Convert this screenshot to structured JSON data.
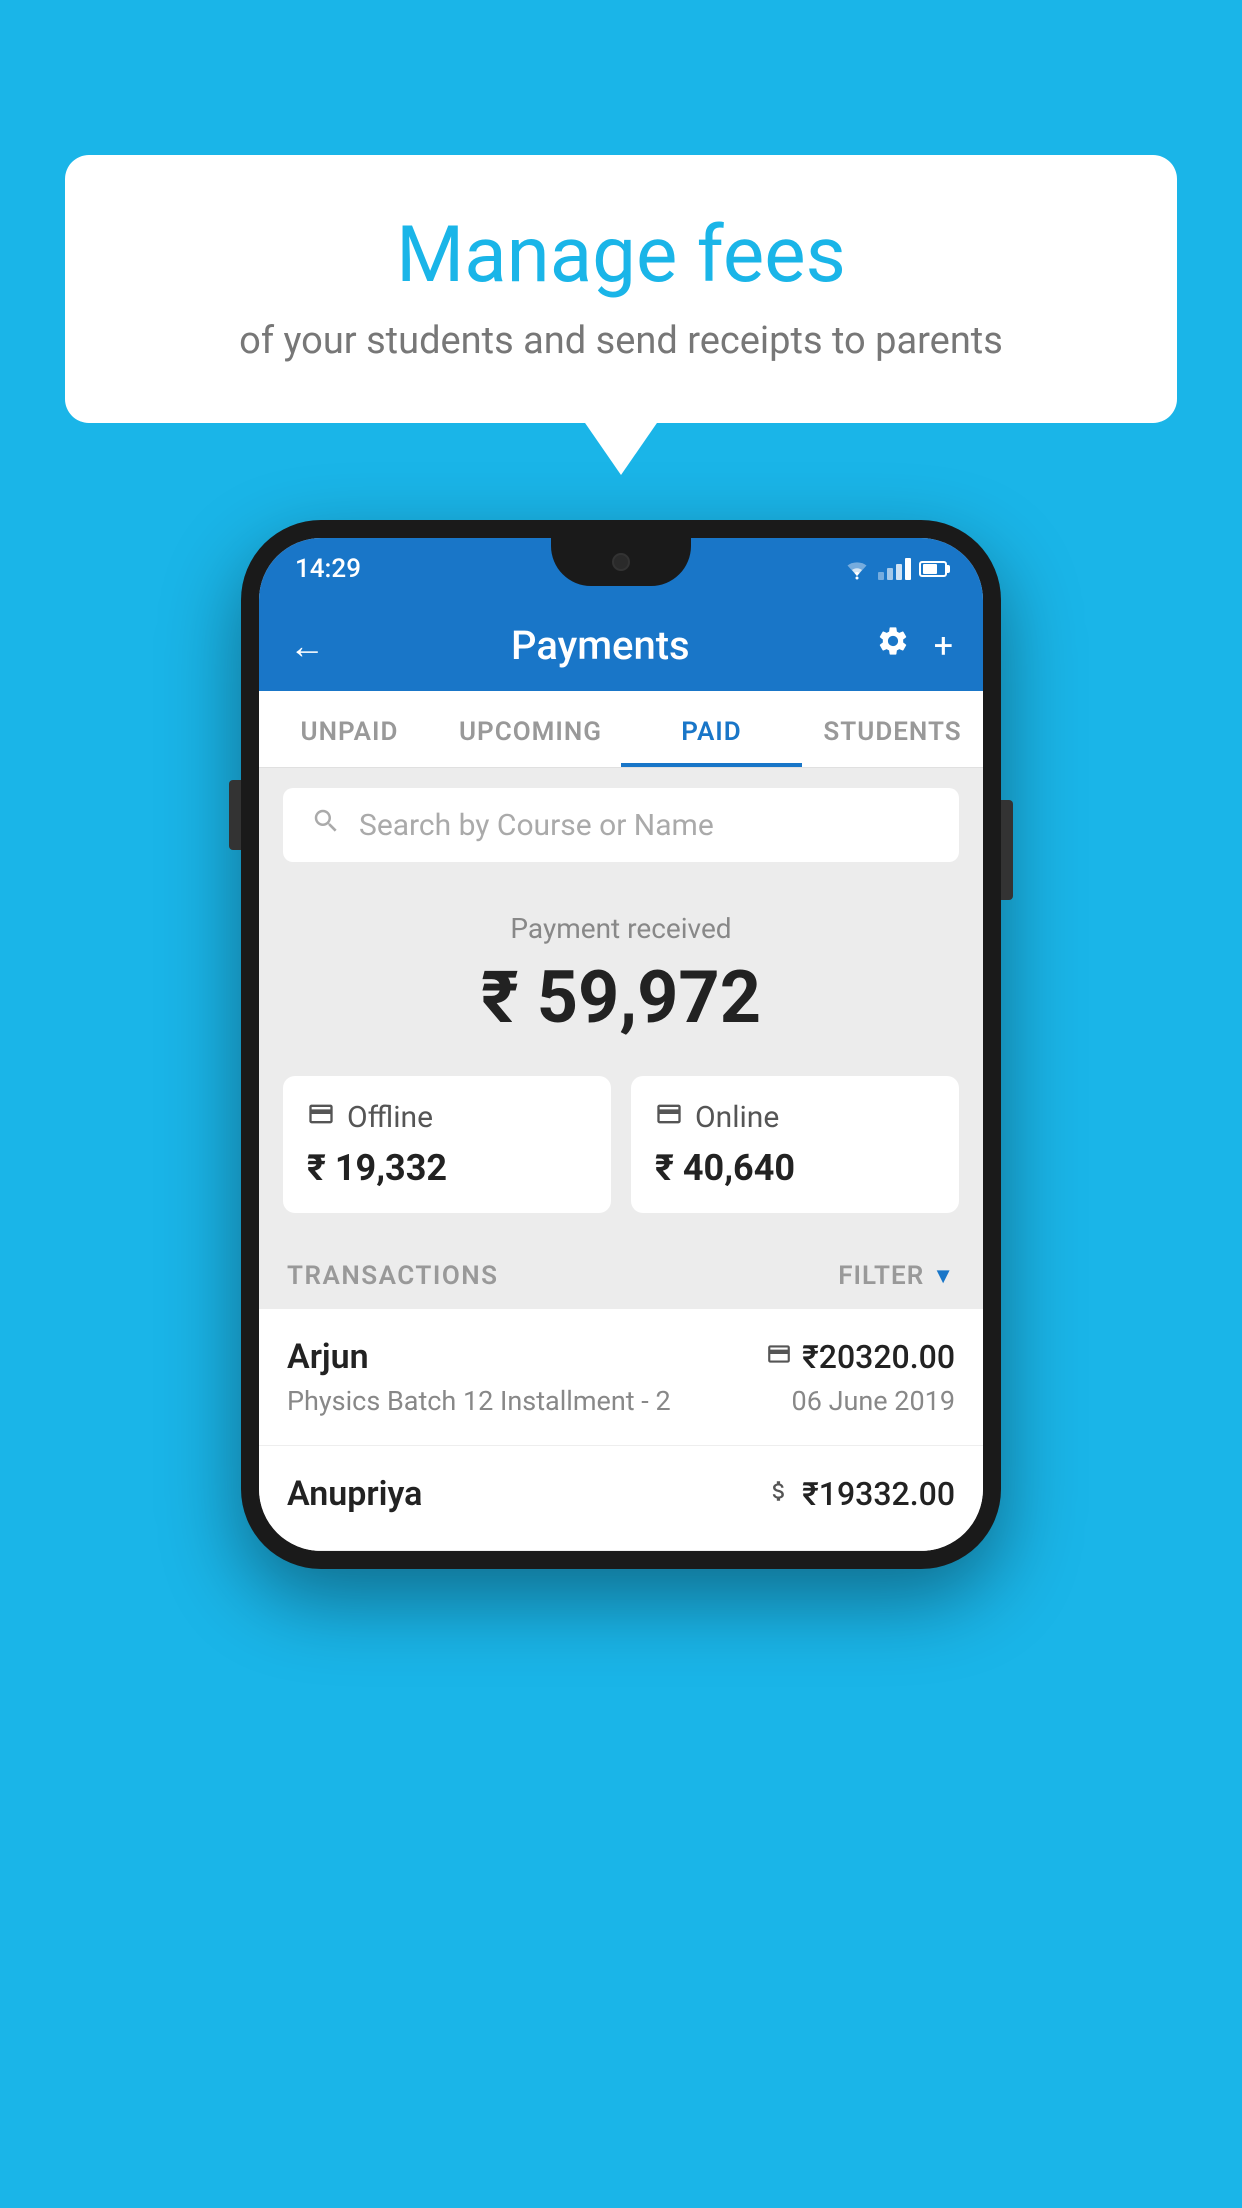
{
  "background_color": "#1ab5e8",
  "speech_bubble": {
    "title": "Manage fees",
    "subtitle": "of your students and send receipts to parents"
  },
  "phone": {
    "status_bar": {
      "time": "14:29"
    },
    "nav_bar": {
      "title": "Payments",
      "back_label": "←",
      "settings_label": "⚙",
      "add_label": "+"
    },
    "tabs": [
      {
        "label": "UNPAID",
        "active": false
      },
      {
        "label": "UPCOMING",
        "active": false
      },
      {
        "label": "PAID",
        "active": true
      },
      {
        "label": "STUDENTS",
        "active": false
      }
    ],
    "search": {
      "placeholder": "Search by Course or Name"
    },
    "payment_received": {
      "label": "Payment received",
      "amount": "₹ 59,972"
    },
    "payment_cards": [
      {
        "icon": "💳",
        "label": "Offline",
        "amount": "₹ 19,332"
      },
      {
        "icon": "💳",
        "label": "Online",
        "amount": "₹ 40,640"
      }
    ],
    "transactions_header": {
      "label": "TRANSACTIONS",
      "filter_label": "FILTER"
    },
    "transactions": [
      {
        "name": "Arjun",
        "course": "Physics Batch 12 Installment - 2",
        "amount": "₹20320.00",
        "date": "06 June 2019",
        "payment_type": "online"
      },
      {
        "name": "Anupriya",
        "course": "",
        "amount": "₹19332.00",
        "date": "",
        "payment_type": "offline"
      }
    ]
  }
}
